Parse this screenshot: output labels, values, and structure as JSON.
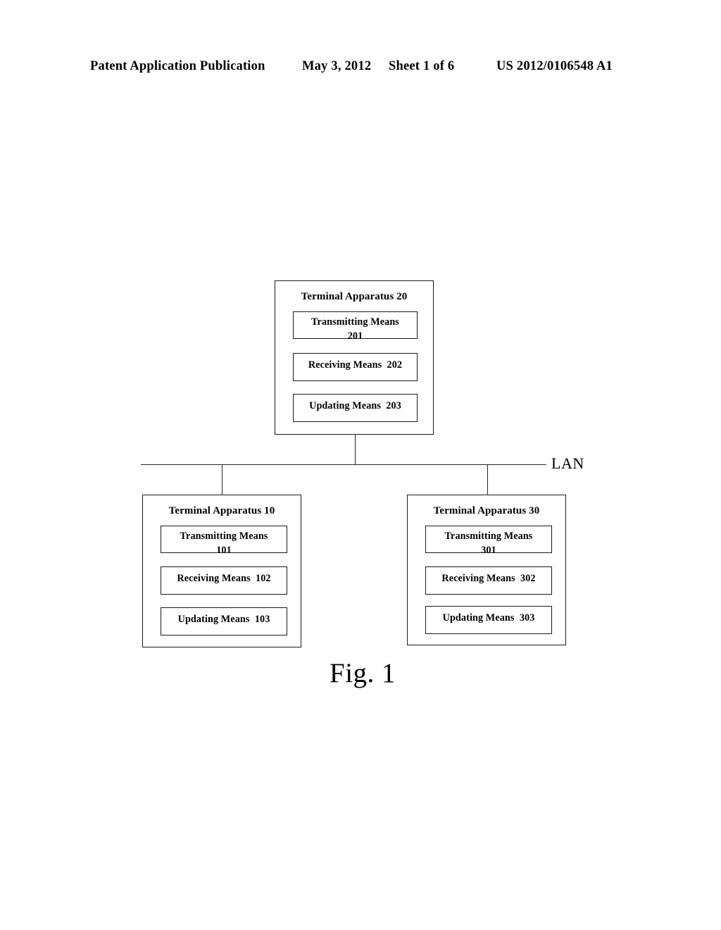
{
  "header": {
    "publication": "Patent Application Publication",
    "date": "May 3, 2012",
    "sheet": "Sheet 1 of 6",
    "number": "US 2012/0106548 A1"
  },
  "figure": {
    "caption": "Fig. 1",
    "network_label": "LAN",
    "nodes": {
      "top": {
        "title": "Terminal Apparatus 20",
        "means": [
          {
            "label": "Transmitting Means",
            "ref": "201"
          },
          {
            "label": "Receiving Means",
            "ref": "202"
          },
          {
            "label": "Updating Means",
            "ref": "203"
          }
        ]
      },
      "left": {
        "title": "Terminal Apparatus  10",
        "means": [
          {
            "label": "Transmitting Means",
            "ref": "101"
          },
          {
            "label": "Receiving Means",
            "ref": "102"
          },
          {
            "label": "Updating Means",
            "ref": "103"
          }
        ]
      },
      "right": {
        "title": "Terminal Apparatus  30",
        "means": [
          {
            "label": "Transmitting Means",
            "ref": "301"
          },
          {
            "label": "Receiving Means",
            "ref": "302"
          },
          {
            "label": "Updating Means",
            "ref": "303"
          }
        ]
      }
    }
  },
  "colors": {
    "ink": "#1a1a1a",
    "paper": "#ffffff"
  }
}
